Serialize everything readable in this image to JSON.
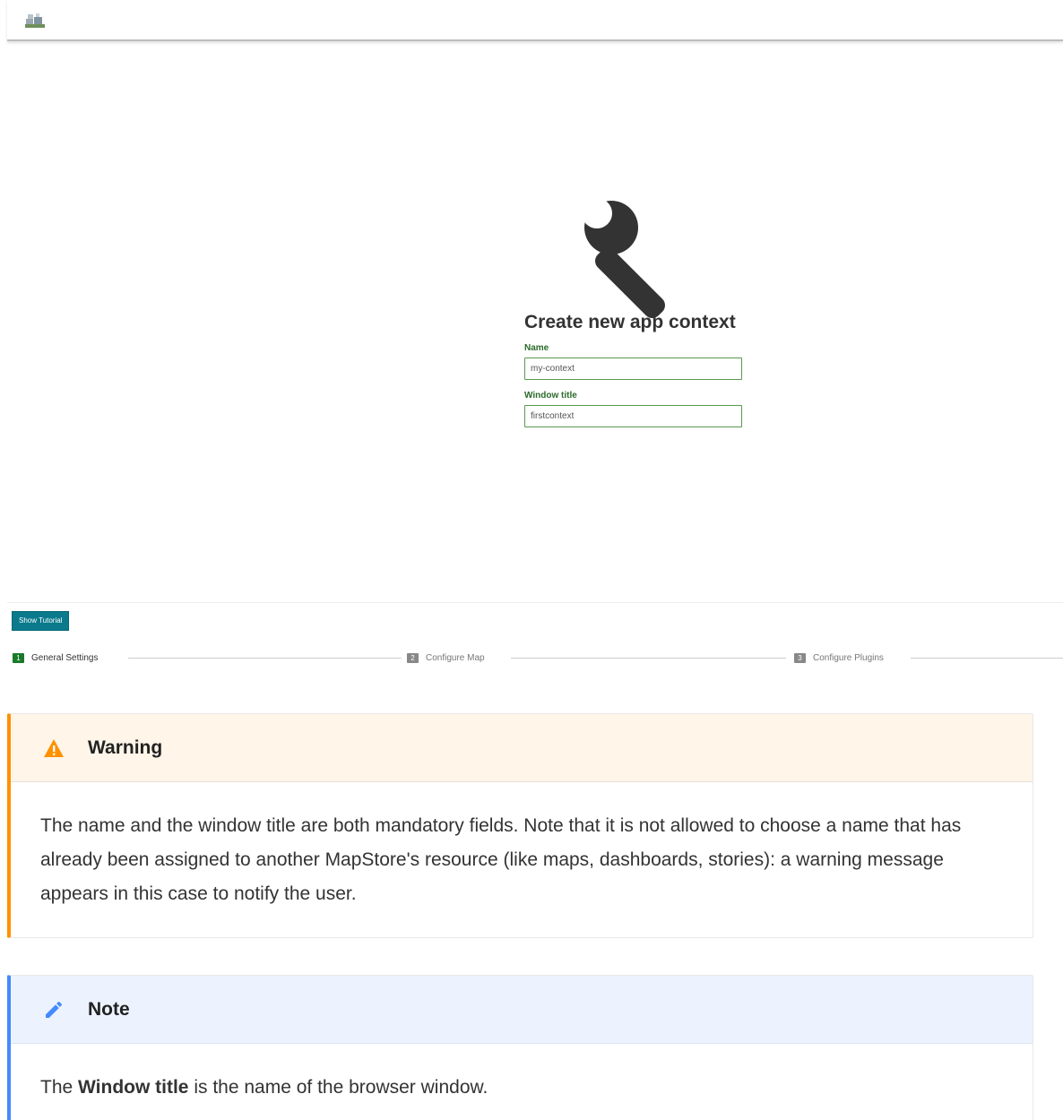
{
  "app": {
    "logo_icon": "app-logo-icon"
  },
  "form": {
    "title": "Create new app context",
    "name_label": "Name",
    "name_value": "my-context",
    "window_title_label": "Window title",
    "window_title_value": "firstcontext",
    "hero_icon": "wrench-icon"
  },
  "wizard": {
    "tutorial_button": "Show Tutorial",
    "steps": [
      {
        "number": "1",
        "label": "General Settings",
        "active": true
      },
      {
        "number": "2",
        "label": "Configure Map",
        "active": false
      },
      {
        "number": "3",
        "label": "Configure Plugins",
        "active": false
      }
    ]
  },
  "warning": {
    "icon": "warning-icon",
    "title": "Warning",
    "body": "The name and the window title are both mandatory fields. Note that it is not allowed to choose a name that has already been assigned to another MapStore's resource (like maps, dashboards, stories): a warning message appears in this case to notify the user.",
    "accent_color": "#ff9100"
  },
  "note": {
    "icon": "pencil-icon",
    "title": "Note",
    "body_prefix": "The ",
    "body_bold": "Window title",
    "body_suffix": " is the name of the browser window.",
    "accent_color": "#448aff"
  }
}
